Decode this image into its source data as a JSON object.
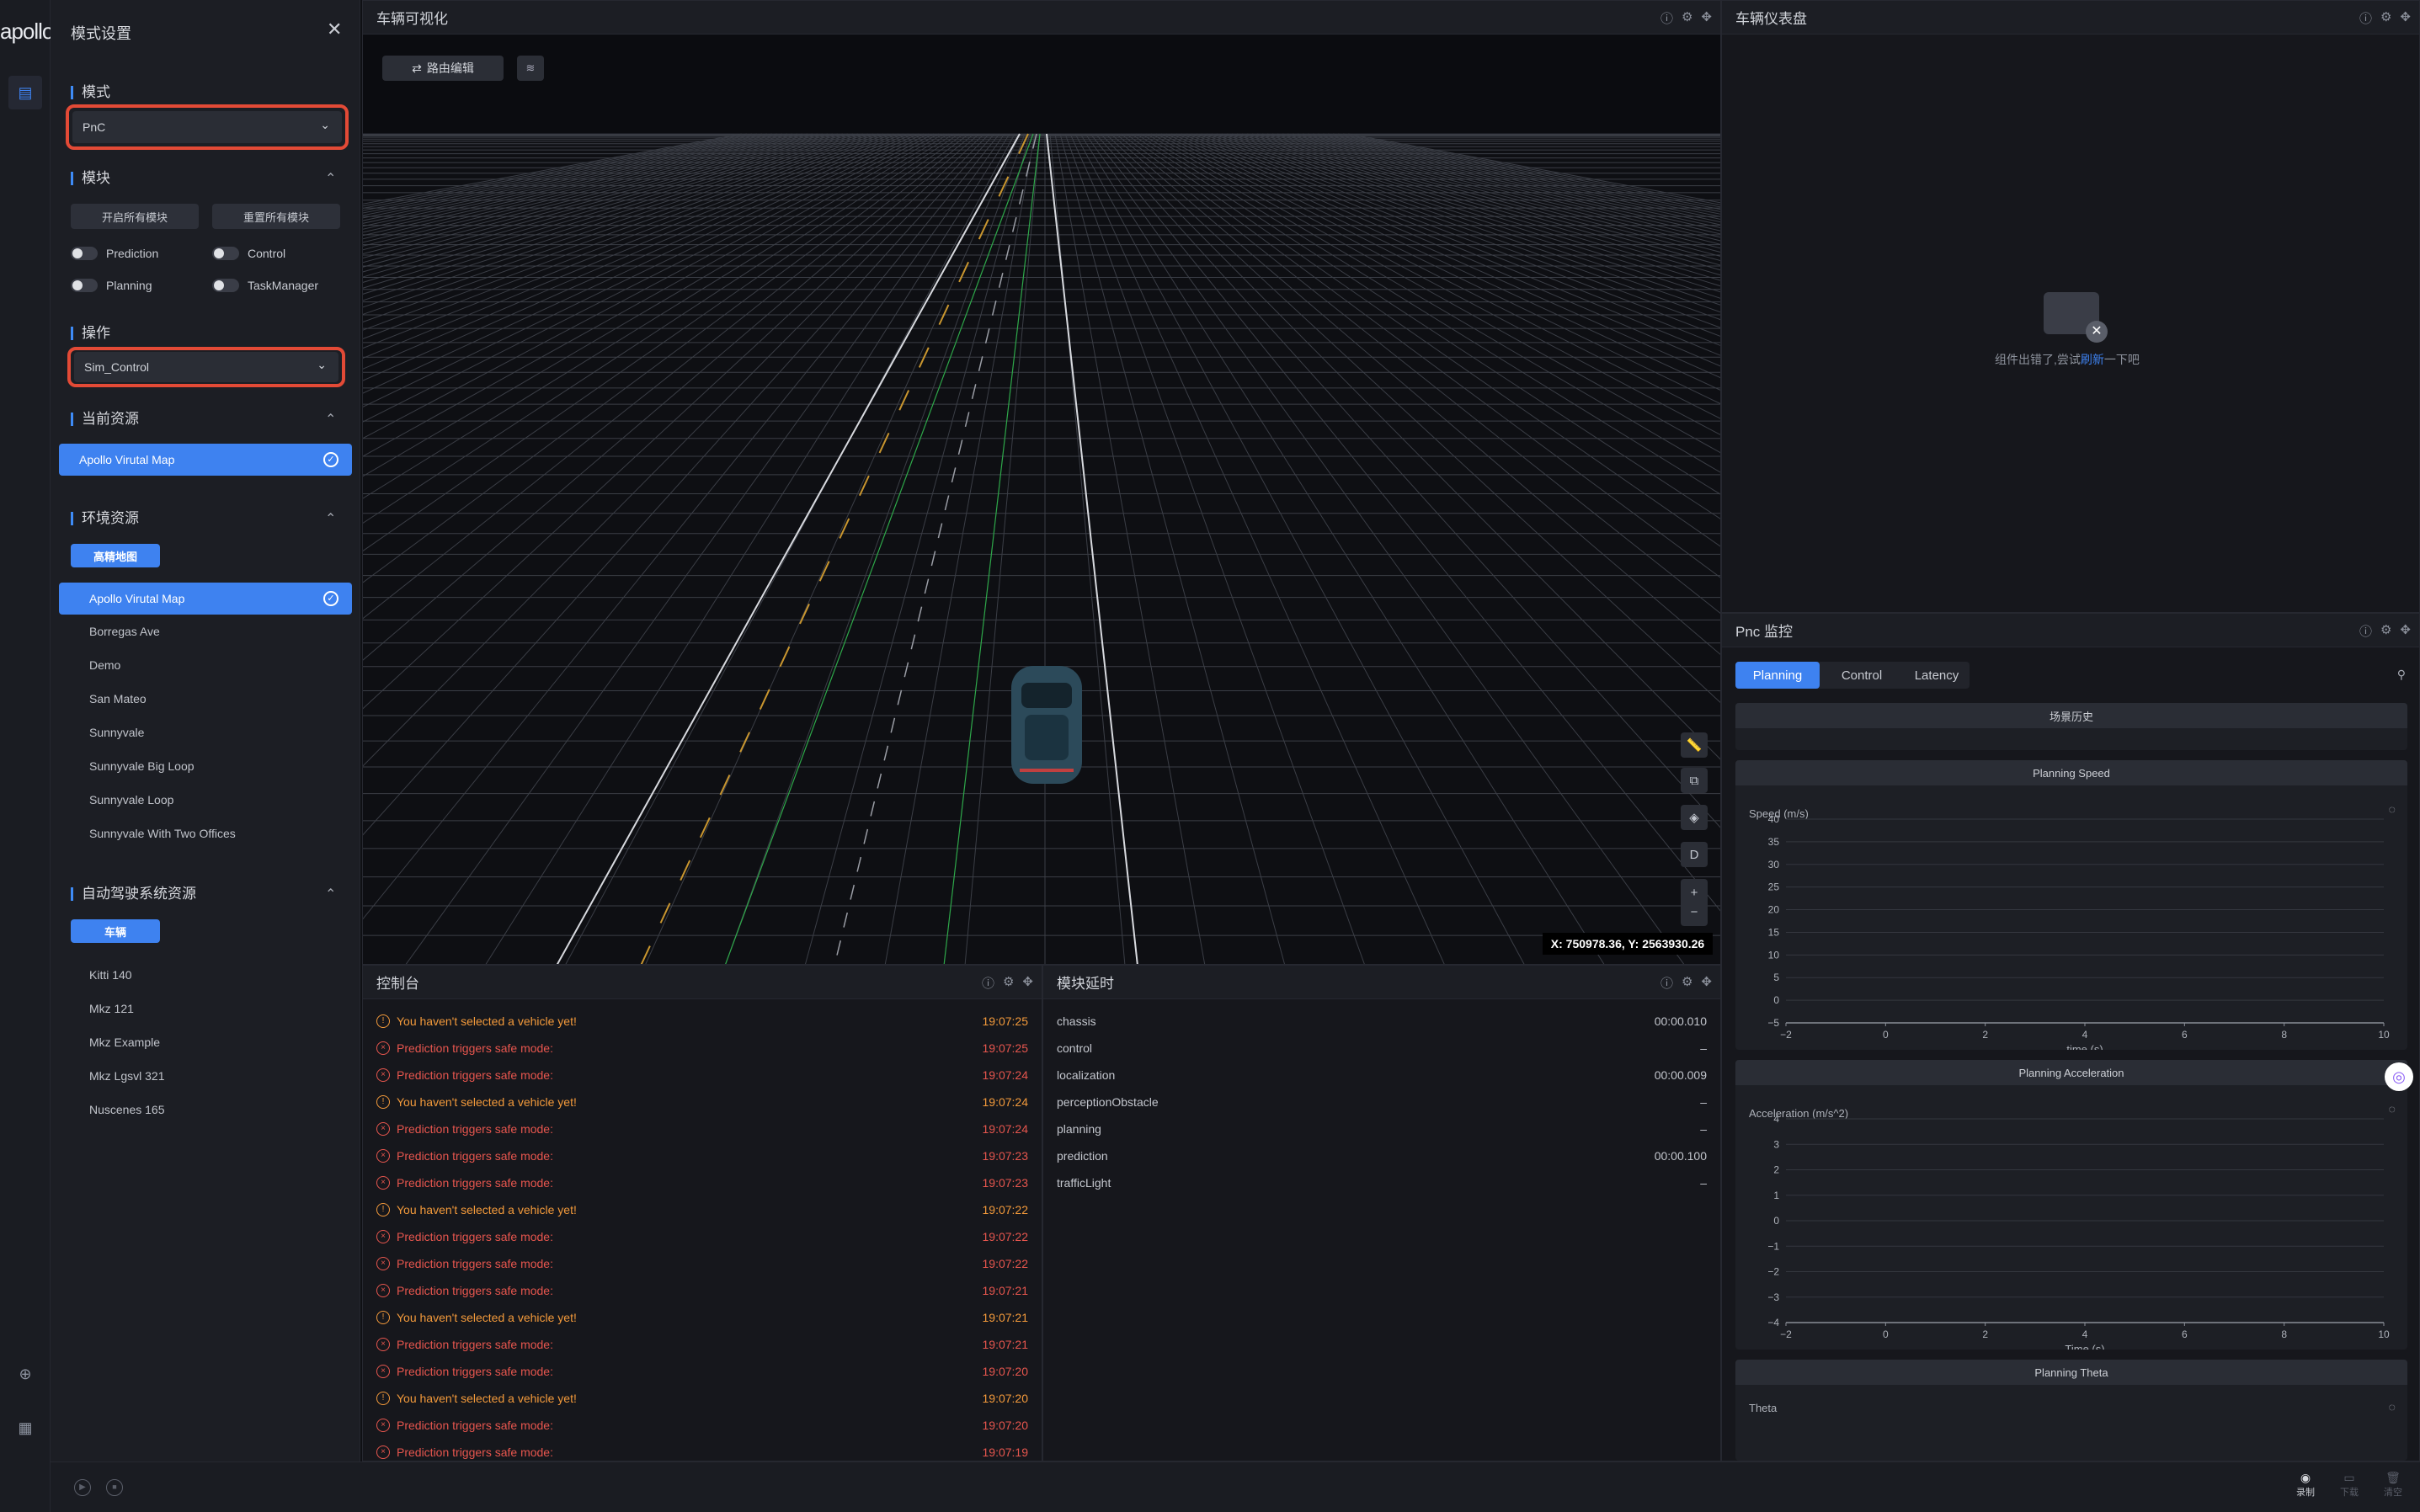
{
  "app": {
    "logo": "apollo"
  },
  "settings": {
    "title": "模式设置",
    "mode_label": "模式",
    "mode_value": "PnC",
    "modules_label": "模块",
    "enable_all": "开启所有模块",
    "reset_all": "重置所有模块",
    "modules": [
      "Prediction",
      "Control",
      "Planning",
      "TaskManager"
    ],
    "operation_label": "操作",
    "operation_value": "Sim_Control",
    "current_resource_label": "当前资源",
    "current_resource": "Apollo Virutal Map",
    "env_resource_label": "环境资源",
    "env_tab": "高精地图",
    "maps": [
      "Apollo Virutal Map",
      "Borregas Ave",
      "Demo",
      "San Mateo",
      "Sunnyvale",
      "Sunnyvale Big Loop",
      "Sunnyvale Loop",
      "Sunnyvale With Two Offices"
    ],
    "ads_resource_label": "自动驾驶系统资源",
    "ads_tab": "车辆",
    "vehicles": [
      "Kitti 140",
      "Mkz 121",
      "Mkz Example",
      "Mkz Lgsvl 321",
      "Nuscenes 165"
    ]
  },
  "viz": {
    "title": "车辆可视化",
    "route_edit": "路由编辑",
    "coords": "X: 750978.36, Y: 2563930.26",
    "tool_d": "D"
  },
  "dashboard": {
    "title": "车辆仪表盘",
    "error_prefix": "组件出错了,尝试",
    "error_link": "刷新",
    "error_suffix": "一下吧"
  },
  "console": {
    "title": "控制台",
    "rows": [
      {
        "type": "warn",
        "msg": "You haven't selected a vehicle yet!",
        "time": "19:07:25"
      },
      {
        "type": "err",
        "msg": "Prediction triggers safe mode:",
        "time": "19:07:25"
      },
      {
        "type": "err",
        "msg": "Prediction triggers safe mode:",
        "time": "19:07:24"
      },
      {
        "type": "warn",
        "msg": "You haven't selected a vehicle yet!",
        "time": "19:07:24"
      },
      {
        "type": "err",
        "msg": "Prediction triggers safe mode:",
        "time": "19:07:24"
      },
      {
        "type": "err",
        "msg": "Prediction triggers safe mode:",
        "time": "19:07:23"
      },
      {
        "type": "err",
        "msg": "Prediction triggers safe mode:",
        "time": "19:07:23"
      },
      {
        "type": "warn",
        "msg": "You haven't selected a vehicle yet!",
        "time": "19:07:22"
      },
      {
        "type": "err",
        "msg": "Prediction triggers safe mode:",
        "time": "19:07:22"
      },
      {
        "type": "err",
        "msg": "Prediction triggers safe mode:",
        "time": "19:07:22"
      },
      {
        "type": "err",
        "msg": "Prediction triggers safe mode:",
        "time": "19:07:21"
      },
      {
        "type": "warn",
        "msg": "You haven't selected a vehicle yet!",
        "time": "19:07:21"
      },
      {
        "type": "err",
        "msg": "Prediction triggers safe mode:",
        "time": "19:07:21"
      },
      {
        "type": "err",
        "msg": "Prediction triggers safe mode:",
        "time": "19:07:20"
      },
      {
        "type": "warn",
        "msg": "You haven't selected a vehicle yet!",
        "time": "19:07:20"
      },
      {
        "type": "err",
        "msg": "Prediction triggers safe mode:",
        "time": "19:07:20"
      },
      {
        "type": "err",
        "msg": "Prediction triggers safe mode:",
        "time": "19:07:19"
      }
    ]
  },
  "latency": {
    "title": "模块延时",
    "rows": [
      {
        "name": "chassis",
        "value": "00:00.010"
      },
      {
        "name": "control",
        "value": "–"
      },
      {
        "name": "localization",
        "value": "00:00.009"
      },
      {
        "name": "perceptionObstacle",
        "value": "–"
      },
      {
        "name": "planning",
        "value": "–"
      },
      {
        "name": "prediction",
        "value": "00:00.100"
      },
      {
        "name": "trafficLight",
        "value": "–"
      }
    ]
  },
  "pnc": {
    "title": "Pnc 监控",
    "tabs": [
      "Planning",
      "Control",
      "Latency"
    ],
    "scenario_history": "场景历史",
    "speed_title": "Planning Speed",
    "accel_title": "Planning Acceleration",
    "theta_title": "Planning Theta",
    "theta_label": "Theta"
  },
  "bottom": {
    "record": "录制",
    "download": "下载",
    "clear": "清空"
  },
  "chart_data": [
    {
      "type": "line",
      "title": "Planning Speed",
      "ylabel": "Speed (m/s)",
      "xlabel": "time (s)",
      "xlim": [
        -2,
        10
      ],
      "ylim": [
        -5,
        40
      ],
      "xticks": [
        "−2",
        "0",
        "2",
        "4",
        "6",
        "8",
        "10"
      ],
      "yticks": [
        "40",
        "35",
        "30",
        "25",
        "20",
        "15",
        "10",
        "5",
        "0",
        "−5"
      ],
      "series": []
    },
    {
      "type": "line",
      "title": "Planning Acceleration",
      "ylabel": "Acceleration (m/s^2)",
      "xlabel": "Time (s)",
      "xlim": [
        -2,
        10
      ],
      "ylim": [
        -4,
        4
      ],
      "xticks": [
        "−2",
        "0",
        "2",
        "4",
        "6",
        "8",
        "10"
      ],
      "yticks": [
        "4",
        "3",
        "2",
        "1",
        "0",
        "−1",
        "−2",
        "−3",
        "−4"
      ],
      "series": []
    }
  ]
}
